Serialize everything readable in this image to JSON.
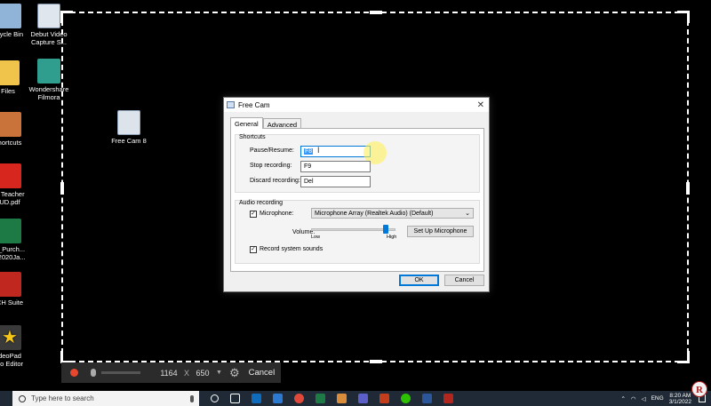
{
  "desktop": {
    "icons": [
      {
        "label1": "cycle Bin",
        "label2": ""
      },
      {
        "label1": "Debut Video",
        "label2": "Capture S..."
      },
      {
        "label1": "Files",
        "label2": ""
      },
      {
        "label1": "Wondershare",
        "label2": "Filmora"
      },
      {
        "label1": "hortcuts",
        "label2": ""
      },
      {
        "label1": "Free Cam 8",
        "label2": ""
      },
      {
        "label1": "A Teacher",
        "label2": "UD.pdf"
      },
      {
        "label1": "a_Purch...",
        "label2": "_2020Ja..."
      },
      {
        "label1": "CH Suite",
        "label2": ""
      },
      {
        "label1": "deoPad",
        "label2": "eo Editor"
      }
    ]
  },
  "recorder_bar": {
    "width": "1164",
    "separator": "X",
    "height": "650",
    "cancel_label": "Cancel"
  },
  "dialog": {
    "title": "Free Cam",
    "tabs": [
      "General",
      "Advanced"
    ],
    "shortcuts": {
      "group_label": "Shortcuts",
      "pause_label": "Pause/Resume:",
      "pause_value": "F8",
      "stop_label": "Stop recording:",
      "stop_value": "F9",
      "discard_label": "Discard recording:",
      "discard_value": "Del"
    },
    "audio": {
      "group_label": "Audio recording",
      "microphone_label": "Microphone:",
      "microphone_checked": true,
      "microphone_device": "Microphone Array (Realtek Audio) (Default)",
      "volume_label": "Volume:",
      "volume_low": "Low",
      "volume_high": "High",
      "volume_level": 0.88,
      "setup_button": "Set Up Microphone",
      "system_sounds_label": "Record system sounds",
      "system_sounds_checked": true
    },
    "ok_label": "OK",
    "cancel_label": "Cancel"
  },
  "taskbar": {
    "search_placeholder": "Type here to search",
    "language": "ENG",
    "time": "8:20 AM",
    "date": "3/1/2022"
  },
  "colors": {
    "accent": "#0078d7",
    "record": "#e8472f",
    "taskbar": "#1f2a36"
  }
}
